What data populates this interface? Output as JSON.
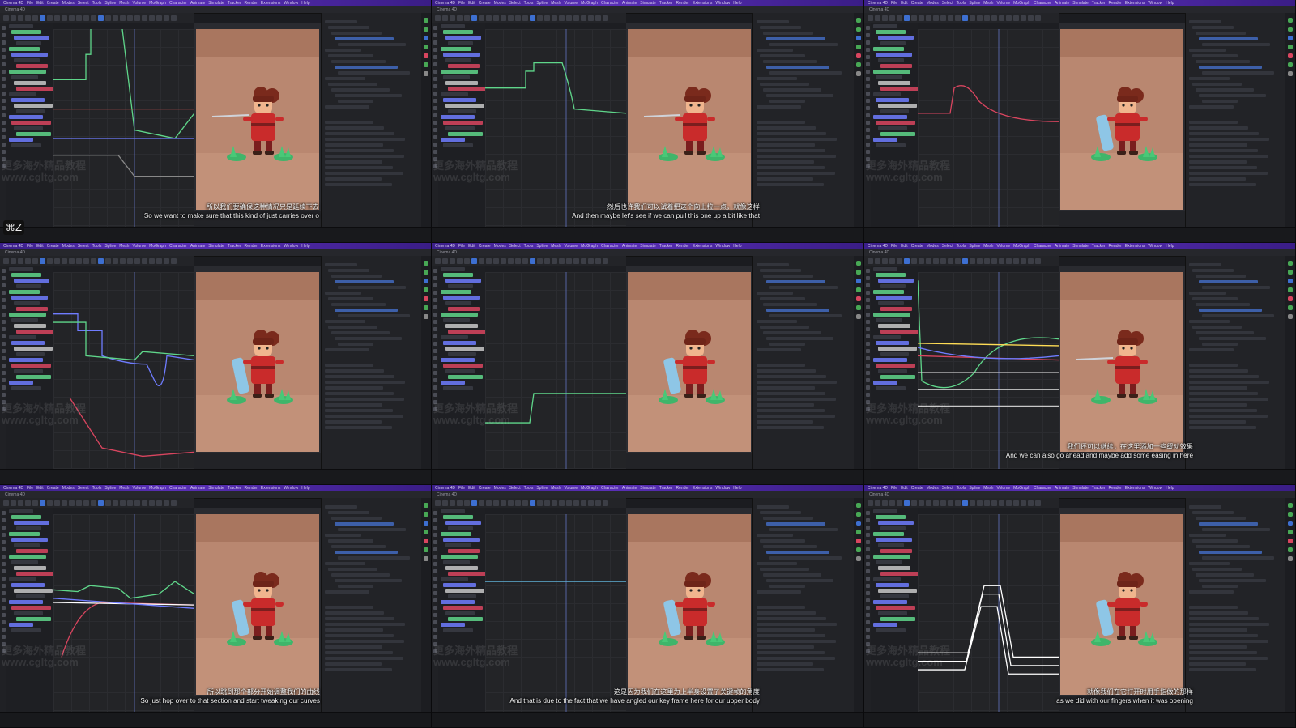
{
  "app": {
    "name": "Cinema 4D",
    "menu": [
      "Cinema 4D",
      "File",
      "Edit",
      "Create",
      "Modes",
      "Select",
      "Tools",
      "Spline",
      "Mesh",
      "Volume",
      "MoGraph",
      "Character",
      "Animate",
      "Simulate",
      "Tracker",
      "Render",
      "Extensions",
      "Window",
      "Help"
    ]
  },
  "watermark": {
    "line1": "更多海外精品教程",
    "line2": "www.cgltg.com"
  },
  "shortcut_badge": "⌘Z",
  "colors": {
    "accent": "#5a2fb8",
    "select": "#3d6fd1",
    "bg": "#1b1c20"
  },
  "panels": [
    {
      "subtitle_zh": "所以我们要确保这种情况只是延续下去",
      "subtitle_en": "So we want to make sure that this kind of just carries over o"
    },
    {
      "subtitle_zh": "然后也许我们可以试着把这个向上拉一点，就像这样",
      "subtitle_en": "And then maybe let's see if we can pull this one up a bit like that"
    },
    {
      "subtitle_zh": "",
      "subtitle_en": ""
    },
    {
      "subtitle_zh": "",
      "subtitle_en": ""
    },
    {
      "subtitle_zh": "",
      "subtitle_en": ""
    },
    {
      "subtitle_zh": "我们还可以继续，在这里添加一些缓动效果",
      "subtitle_en": "And we can also go ahead and maybe add some easing in here"
    },
    {
      "subtitle_zh": "所以跳到那个部分开始调整我们的曲线",
      "subtitle_en": "So just hop over to that section and start tweaking our curves"
    },
    {
      "subtitle_zh": "这是因为我们在这里为上半身设置了关键帧的角度",
      "subtitle_en": "And that is due to the fact that we have angled our key frame here for our upper body"
    },
    {
      "subtitle_zh": "就像我们在它打开时用手指做的那样",
      "subtitle_en": "as we did with our fingers when it was opening"
    }
  ]
}
